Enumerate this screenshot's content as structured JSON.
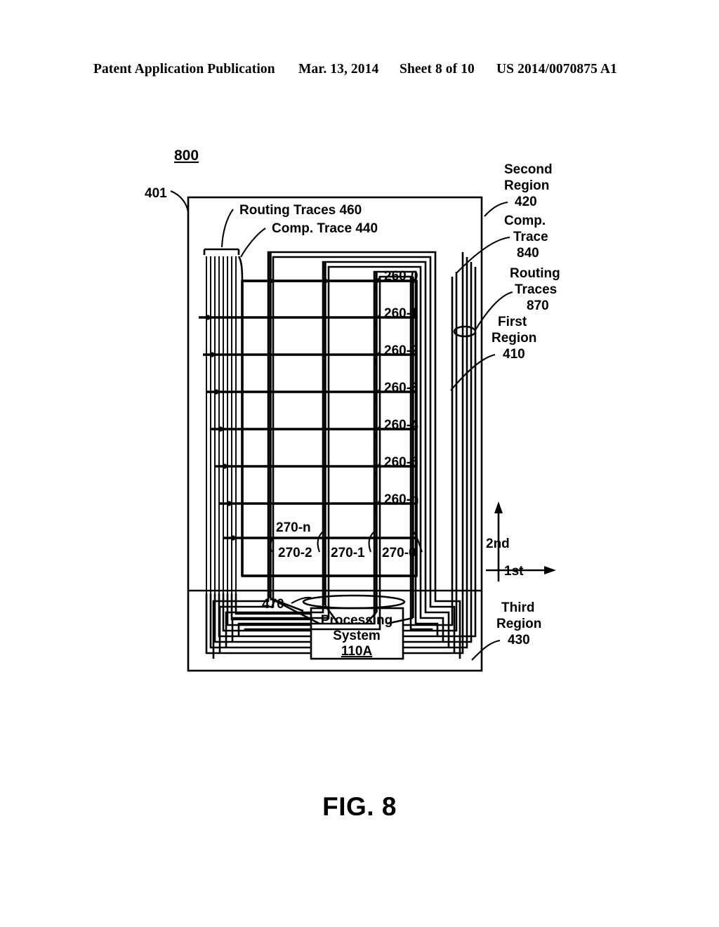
{
  "header": {
    "publication": "Patent Application Publication",
    "date": "Mar. 13, 2014",
    "sheet": "Sheet 8 of 10",
    "patent_number": "US 2014/0070875 A1"
  },
  "figure": {
    "caption": "FIG. 8",
    "figure_ref": "800",
    "device_ref": "401",
    "labels": {
      "routing_traces_460": "Routing Traces 460",
      "comp_trace_440": "Comp. Trace 440",
      "second_region_l1": "Second",
      "second_region_l2": "Region",
      "second_region_num": "420",
      "comp_trace_840_l1": "Comp.",
      "comp_trace_840_l2": "Trace",
      "comp_trace_840_num": "840",
      "routing_traces_870_l1": "Routing",
      "routing_traces_870_l2": "Traces",
      "routing_traces_870_num": "870",
      "first_region_l1": "First",
      "first_region_l2": "Region",
      "first_region_num": "410",
      "third_region_l1": "Third",
      "third_region_l2": "Region",
      "third_region_num": "430",
      "sensor_bus_470": "470"
    },
    "axis": {
      "vertical": "2nd",
      "horizontal": "1st"
    },
    "processing_system": {
      "line1": "Processing",
      "line2": "System",
      "line3": "110A"
    },
    "row_electrodes": [
      "260-0",
      "260-1",
      "260-2",
      "260-3",
      "260-4",
      "260-5",
      "260-n"
    ],
    "column_electrodes": [
      "270-n",
      "270-2",
      "270-1",
      "270-0"
    ]
  },
  "colors": {
    "ink": "#000000",
    "paper": "#ffffff"
  }
}
